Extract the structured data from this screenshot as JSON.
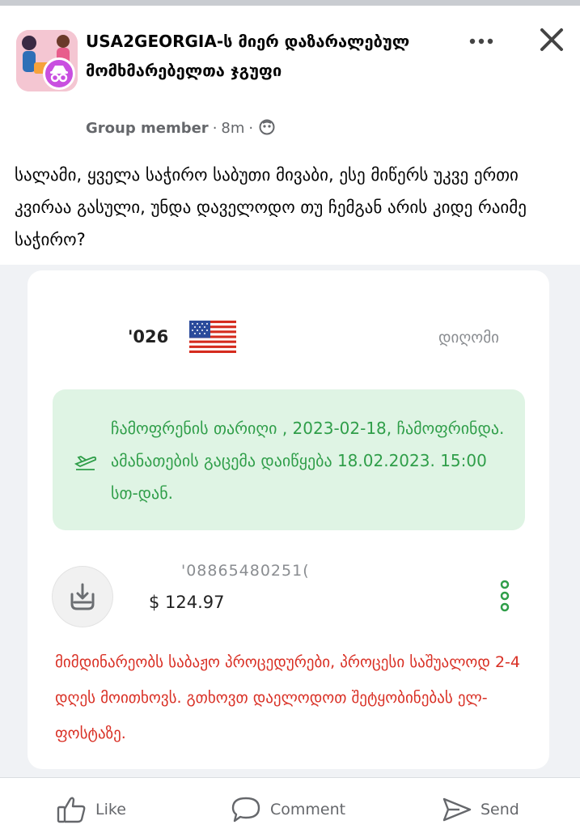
{
  "post": {
    "group_name": "USA2GEORGIA-ს მიერ დაზარალებულ მომხმარებელთა ჯგუფი",
    "role": "Group member",
    "time": "8m",
    "body": "სალამი, ყველა საჭირო საბუთი მივაბი, ესე მიწერს უკვე ერთი კვირაა გასული, უნდა დაველოდო თუ ჩემგან არის კიდე რაიმე საჭირო?"
  },
  "screenshot": {
    "code": "'026",
    "status": "დიღომი",
    "notice": "ჩამოფრენის თარიღი , 2023-02-18, ჩამოფრინდა. ამანათების გაცემა დაიწყება 18.02.2023. 15:00 სთ-დან.",
    "tracking": "'08865480251(",
    "price": "$ 124.97",
    "customs": "მიმდინარეობს საბაჟო პროცედურები, პროცესი საშუალოდ 2-4 დღეს მოითხოვს. გთხოვთ დაელოდოთ შეტყობინებას ელ-ფოსტაზე."
  },
  "actions": {
    "like": "Like",
    "comment": "Comment",
    "send": "Send"
  },
  "colors": {
    "notice_bg": "#dff4e4",
    "notice_text": "#2f9e49",
    "customs_text": "#d93025",
    "meta_text": "#65676b"
  },
  "icons": [
    "more-icon",
    "close-icon",
    "globe-icon",
    "us-flag-icon",
    "plane-icon",
    "download-icon",
    "kebab-icon",
    "like-icon",
    "comment-icon",
    "send-icon"
  ]
}
